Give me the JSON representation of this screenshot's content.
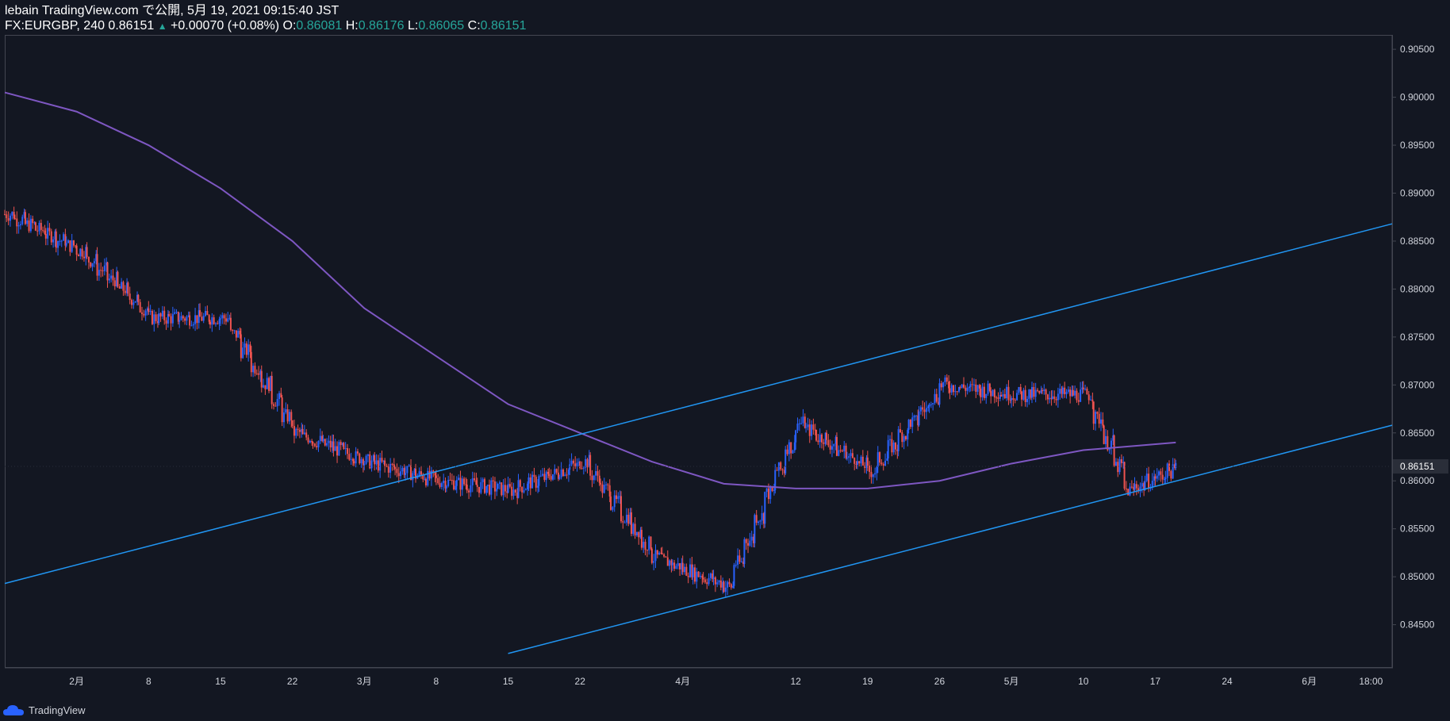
{
  "header": {
    "line1": "lebain TradingView.com で公開, 5月 19, 2021 09:15:40 JST",
    "symbol": "FX:EURGBP, 240 0.86151",
    "change": "+0.00070 (+0.08%)",
    "o_label": "O:",
    "o_val": "0.86081",
    "h_label": "H:",
    "h_val": "0.86176",
    "l_label": "L:",
    "l_val": "0.86065",
    "c_label": "C:",
    "c_val": "0.86151"
  },
  "footer": {
    "brand": "TradingView"
  },
  "colors": {
    "background": "#131722",
    "up": "#2962ff",
    "down": "#ef5350",
    "ma": "#7e57c2",
    "channel": "#2196f3",
    "axis_text": "#d1d4dc"
  },
  "chart_data": {
    "type": "line",
    "ylim": [
      0.8405,
      0.9065
    ],
    "last_price": "0.86151",
    "y_ticks": [
      "0.90500",
      "0.90000",
      "0.89500",
      "0.89000",
      "0.88500",
      "0.88000",
      "0.87500",
      "0.87000",
      "0.86500",
      "0.86000",
      "0.85500",
      "0.85000",
      "0.84500"
    ],
    "x_ticks": [
      "2月",
      "8",
      "15",
      "22",
      "3月",
      "8",
      "15",
      "22",
      "4月",
      "12",
      "19",
      "26",
      "5月",
      "10",
      "17",
      "24",
      "6月",
      "18:00"
    ],
    "series": [
      {
        "type": "line",
        "x": [
          "01-25",
          "02-01",
          "02-08",
          "02-15",
          "02-22",
          "03-01",
          "03-08",
          "03-15",
          "03-22",
          "03-29",
          "04-05",
          "04-12",
          "04-19",
          "04-26",
          "05-03",
          "05-10",
          "05-14",
          "05-19"
        ],
        "values": [
          0.8878,
          0.884,
          0.877,
          0.877,
          0.865,
          0.862,
          0.86,
          0.859,
          0.862,
          0.852,
          0.849,
          0.866,
          0.861,
          0.87,
          0.869,
          0.869,
          0.859,
          0.8615
        ]
      },
      {
        "type": "line",
        "x": [
          "01-25",
          "02-01",
          "02-08",
          "02-15",
          "02-22",
          "03-01",
          "03-08",
          "03-15",
          "03-22",
          "03-29",
          "04-05",
          "04-12",
          "04-19",
          "04-26",
          "05-03",
          "05-10",
          "05-19"
        ],
        "values": [
          0.9005,
          0.8985,
          0.895,
          0.8905,
          0.885,
          0.878,
          0.873,
          0.868,
          0.865,
          0.862,
          0.8597,
          0.8592,
          0.8592,
          0.86,
          0.8618,
          0.8632,
          0.864
        ]
      },
      {
        "type": "line",
        "x": [
          "01-25",
          "06-19"
        ],
        "values": [
          0.8493,
          0.8868
        ]
      },
      {
        "type": "line",
        "x": [
          "03-15",
          "06-19"
        ],
        "values": [
          0.842,
          0.8658
        ]
      }
    ]
  }
}
